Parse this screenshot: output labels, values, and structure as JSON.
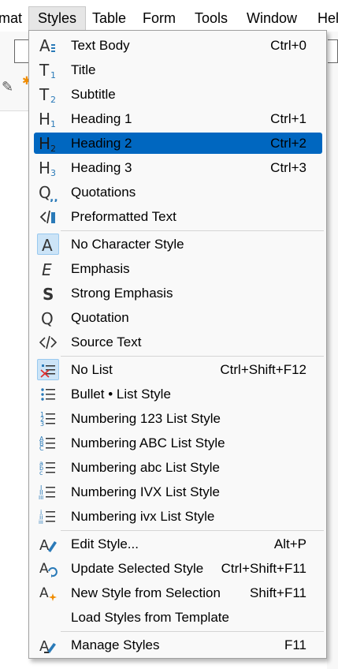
{
  "menubar": {
    "items": [
      {
        "label": "mat"
      },
      {
        "label": "Styles"
      },
      {
        "label": "Table"
      },
      {
        "label": "Form"
      },
      {
        "label": "Tools"
      },
      {
        "label": "Window"
      },
      {
        "label": "Hel"
      }
    ]
  },
  "menu": {
    "items": [
      {
        "icon": "paragraph-style-text-body-icon",
        "label": "Text Body",
        "shortcut": "Ctrl+0"
      },
      {
        "icon": "paragraph-style-title-icon",
        "label": "Title",
        "shortcut": ""
      },
      {
        "icon": "paragraph-style-subtitle-icon",
        "label": "Subtitle",
        "shortcut": ""
      },
      {
        "icon": "heading-1-icon",
        "label": "Heading 1",
        "shortcut": "Ctrl+1"
      },
      {
        "icon": "heading-2-icon",
        "label": "Heading 2",
        "shortcut": "Ctrl+2"
      },
      {
        "icon": "heading-3-icon",
        "label": "Heading 3",
        "shortcut": "Ctrl+3"
      },
      {
        "icon": "quotations-icon",
        "label": "Quotations",
        "shortcut": ""
      },
      {
        "icon": "preformatted-text-icon",
        "label": "Preformatted Text",
        "shortcut": ""
      },
      {
        "icon": "no-character-style-icon",
        "label": "No Character Style",
        "shortcut": ""
      },
      {
        "icon": "emphasis-icon",
        "label": "Emphasis",
        "shortcut": ""
      },
      {
        "icon": "strong-emphasis-icon",
        "label": "Strong Emphasis",
        "shortcut": ""
      },
      {
        "icon": "quotation-icon",
        "label": "Quotation",
        "shortcut": ""
      },
      {
        "icon": "source-text-icon",
        "label": "Source Text",
        "shortcut": ""
      },
      {
        "icon": "no-list-icon",
        "label": "No List",
        "shortcut": "Ctrl+Shift+F12"
      },
      {
        "icon": "bullet-list-icon",
        "label": "Bullet • List Style",
        "shortcut": ""
      },
      {
        "icon": "numbering-123-icon",
        "label": "Numbering 123 List Style",
        "shortcut": ""
      },
      {
        "icon": "numbering-abc-upper-icon",
        "label": "Numbering ABC List Style",
        "shortcut": ""
      },
      {
        "icon": "numbering-abc-lower-icon",
        "label": "Numbering abc List Style",
        "shortcut": ""
      },
      {
        "icon": "numbering-ivx-upper-icon",
        "label": "Numbering IVX List Style",
        "shortcut": ""
      },
      {
        "icon": "numbering-ivx-lower-icon",
        "label": "Numbering ivx List Style",
        "shortcut": ""
      },
      {
        "icon": "edit-style-icon",
        "label": "Edit Style...",
        "shortcut": "Alt+P"
      },
      {
        "icon": "update-style-icon",
        "label": "Update Selected Style",
        "shortcut": "Ctrl+Shift+F11"
      },
      {
        "icon": "new-style-icon",
        "label": "New Style from Selection",
        "shortcut": "Shift+F11"
      },
      {
        "icon": "",
        "label": "Load Styles from Template",
        "shortcut": ""
      },
      {
        "icon": "manage-styles-icon",
        "label": "Manage Styles",
        "shortcut": "F11"
      }
    ]
  },
  "colors": {
    "highlight": "#0067c0",
    "menu_bg": "#f9f9f9",
    "icon_selected_bg": "#cce4f7",
    "accent_orange": "#f08c00",
    "icon_blue": "#2a7ab8"
  }
}
